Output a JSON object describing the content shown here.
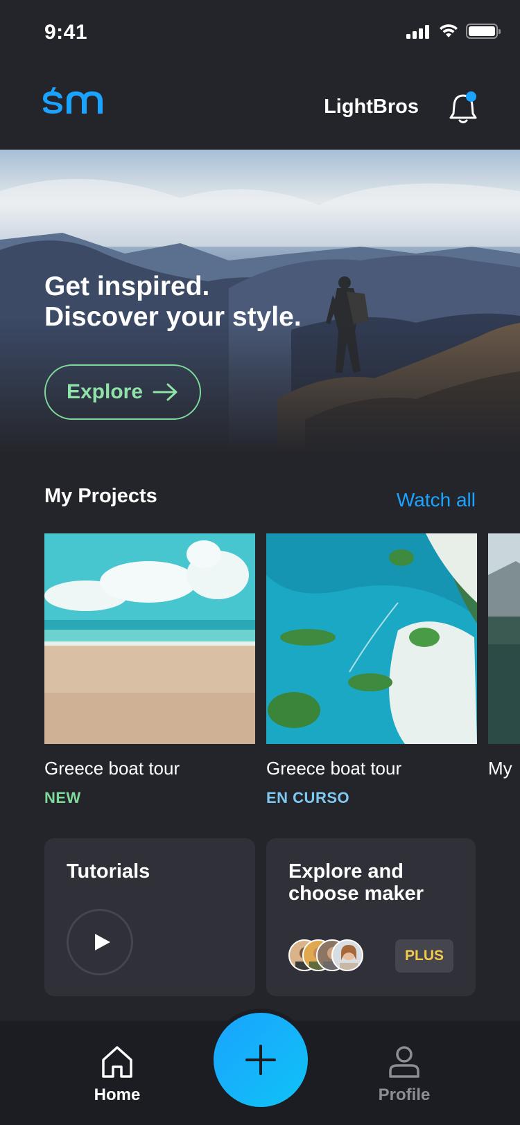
{
  "status_bar": {
    "time": "9:41"
  },
  "header": {
    "username": "LightBros"
  },
  "hero": {
    "line1": "Get inspired.",
    "line2": "Discover your style.",
    "button_label": "Explore"
  },
  "projects": {
    "title": "My Projects",
    "watch_all": "Watch all",
    "items": [
      {
        "name": "Greece boat tour",
        "status": "NEW",
        "status_color": "#7fd99b"
      },
      {
        "name": "Greece boat tour",
        "status": "EN CURSO",
        "status_color": "#7fc8f2"
      },
      {
        "name": "My",
        "status": "",
        "status_color": "#ffffff"
      }
    ]
  },
  "cards": {
    "tutorials": {
      "title": "Tutorials"
    },
    "makers": {
      "title_line1": "Explore and",
      "title_line2": "choose maker",
      "badge": "PLUS"
    }
  },
  "bottom_nav": {
    "home": "Home",
    "profile": "Profile"
  },
  "colors": {
    "accent": "#1aa3ff",
    "explore_green": "#7fd99b",
    "plus_gold": "#f2c94c"
  },
  "icons": [
    "signal-icon",
    "wifi-icon",
    "battery-icon",
    "bell-icon",
    "arrow-right-icon",
    "play-icon",
    "home-icon",
    "plus-icon",
    "profile-icon"
  ]
}
